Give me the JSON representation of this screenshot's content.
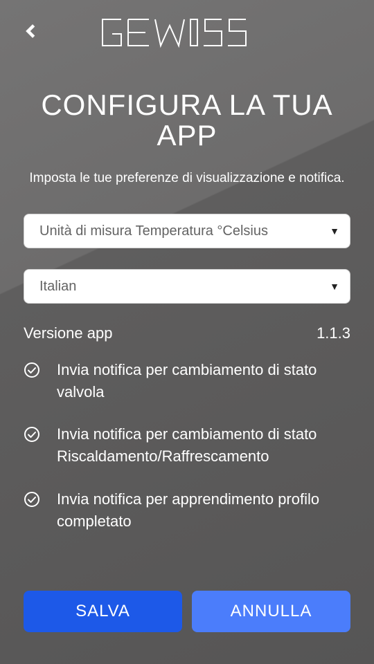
{
  "brand": "GEWISS",
  "header": {
    "title": "CONFIGURA LA TUA APP",
    "subtitle": "Imposta le tue preferenze di visualizzazione e notifica."
  },
  "selects": {
    "temperature": {
      "selected": "Unità di misura Temperatura °Celsius"
    },
    "language": {
      "selected": "Italian"
    }
  },
  "version": {
    "label": "Versione app",
    "value": "1.1.3"
  },
  "options": [
    {
      "label": "Invia notifica per cambiamento di stato valvola",
      "checked": true
    },
    {
      "label": "Invia notifica per cambiamento di stato Riscaldamento/Raffrescamento",
      "checked": true
    },
    {
      "label": "Invia notifica per apprendimento profilo completato",
      "checked": true
    }
  ],
  "buttons": {
    "save": "SALVA",
    "cancel": "ANNULLA"
  }
}
